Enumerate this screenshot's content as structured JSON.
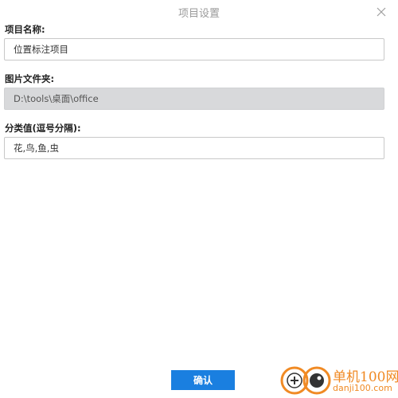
{
  "dialog": {
    "title": "项目设置"
  },
  "fields": {
    "project_name": {
      "label": "项目名称:",
      "value": "位置标注项目"
    },
    "image_folder": {
      "label": "图片文件夹:",
      "value": "D:\\tools\\桌面\\office"
    },
    "categories": {
      "label": "分类值(逗号分隔):",
      "value": "花,鸟,鱼,虫"
    }
  },
  "footer": {
    "confirm_label": "确认"
  },
  "watermark": {
    "name": "单机100网",
    "url": "danji100.com"
  },
  "colors": {
    "accent": "#1a7fe0",
    "watermark": "#f08a24",
    "disabled_bg": "#d8d9db"
  }
}
